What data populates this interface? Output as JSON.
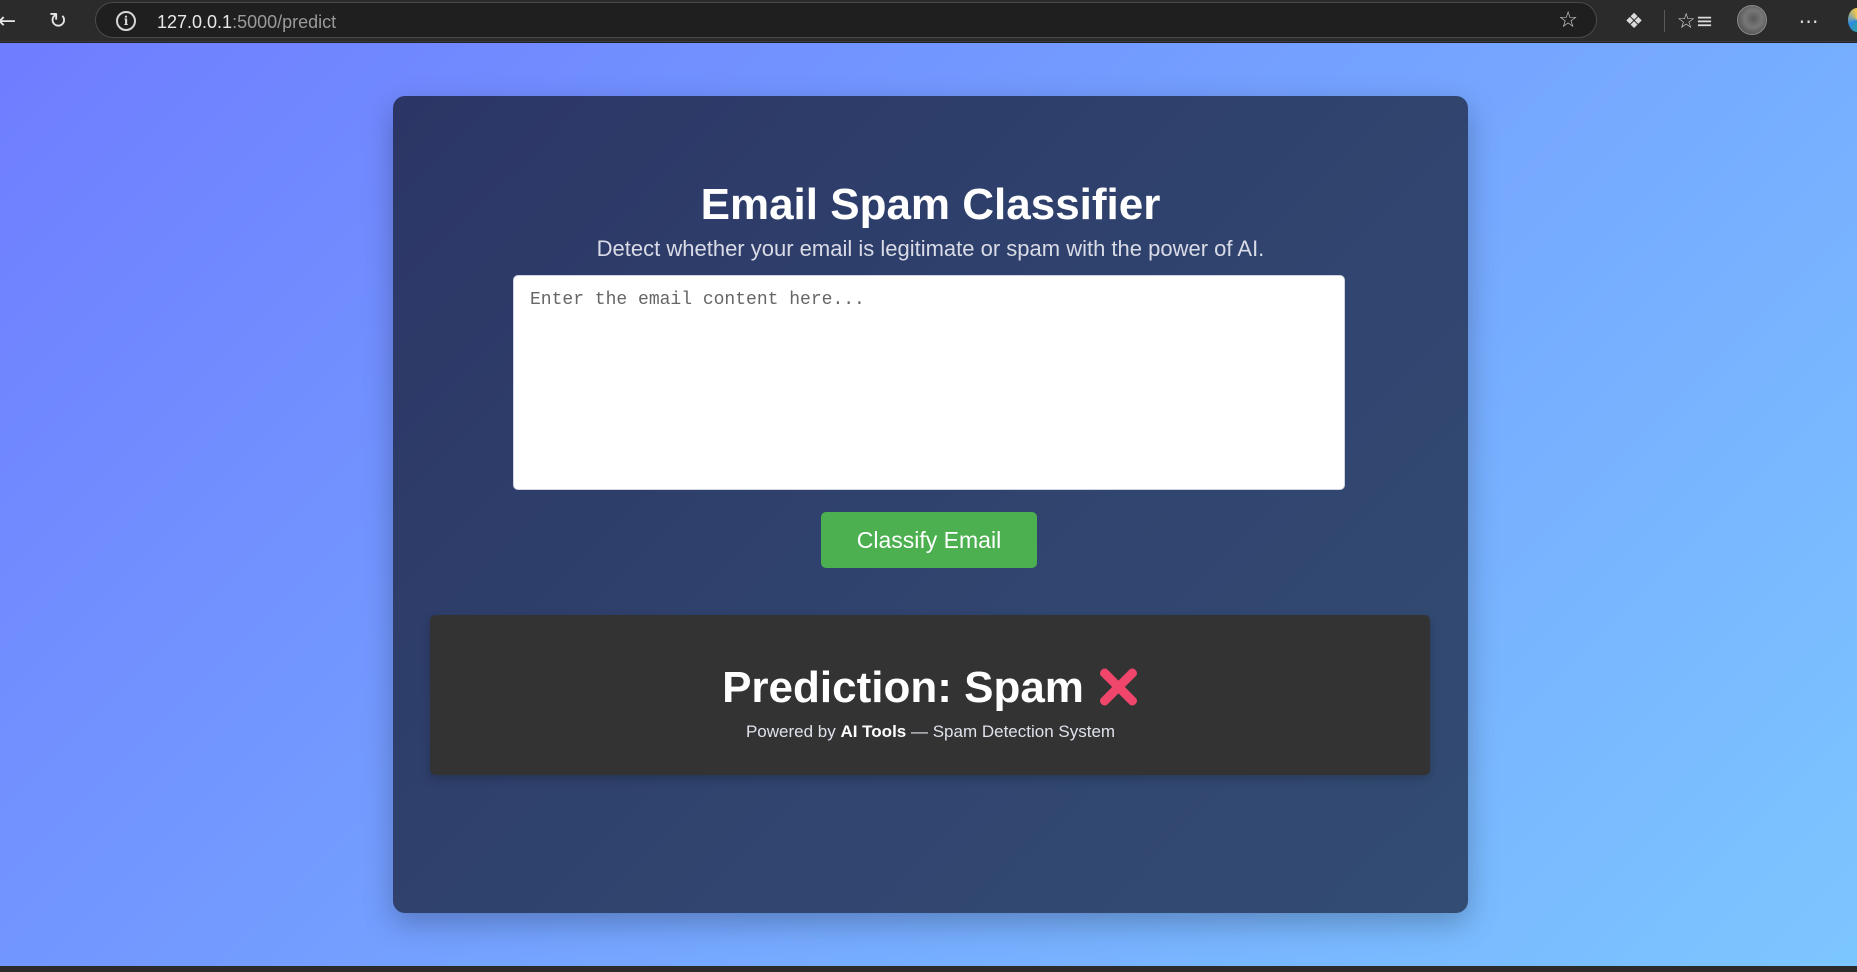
{
  "browser": {
    "url_host": "127.0.0.1",
    "url_path": ":5000/predict",
    "icons": [
      "back-icon",
      "reload-icon",
      "info-icon",
      "star-icon",
      "extensions-icon",
      "favorites-icon",
      "profile-avatar",
      "more-icon",
      "edge-icon"
    ]
  },
  "app": {
    "title": "Email Spam Classifier",
    "subtitle": "Detect whether your email is legitimate or spam with the power of AI.",
    "input_placeholder": "Enter the email content here...",
    "input_value": "",
    "button_label": "Classify Email",
    "prediction": "Prediction: Spam",
    "prediction_icon": "cross-mark-icon",
    "footer_prefix": "Powered by",
    "footer_brand": "AI Tools",
    "footer_suffix": "— Spam Detection System"
  },
  "colors": {
    "button": "#4caf50",
    "result_background": "#333333",
    "cross_mark": "#f0466b"
  }
}
